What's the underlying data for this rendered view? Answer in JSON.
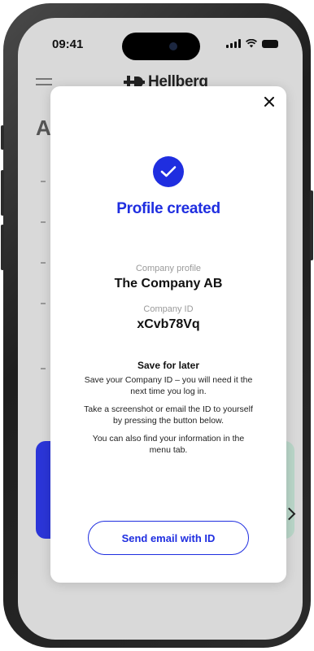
{
  "status_bar": {
    "time": "09:41"
  },
  "app_header": {
    "brand_name": "Hellberg"
  },
  "background": {
    "title_initial": "A"
  },
  "modal": {
    "title": "Profile created",
    "company_profile_label": "Company profile",
    "company_profile_value": "The Company AB",
    "company_id_label": "Company ID",
    "company_id_value": "xCvb78Vq",
    "save_title": "Save for later",
    "paragraph_1": "Save your Company ID – you will need it the next time you log in.",
    "paragraph_2": "Take a screenshot  or email the ID to yourself by pressing the button below.",
    "paragraph_3": "You can also find your information in the menu tab.",
    "email_button_label": "Send email with ID"
  },
  "colors": {
    "accent": "#1f2ee0",
    "backdrop": "#d9d9d9",
    "green_card": "#b9d6c8"
  },
  "icons": {
    "close": "close-icon",
    "check": "checkmark-icon",
    "menu": "hamburger-menu-icon",
    "logo": "hellberg-logo-icon"
  }
}
